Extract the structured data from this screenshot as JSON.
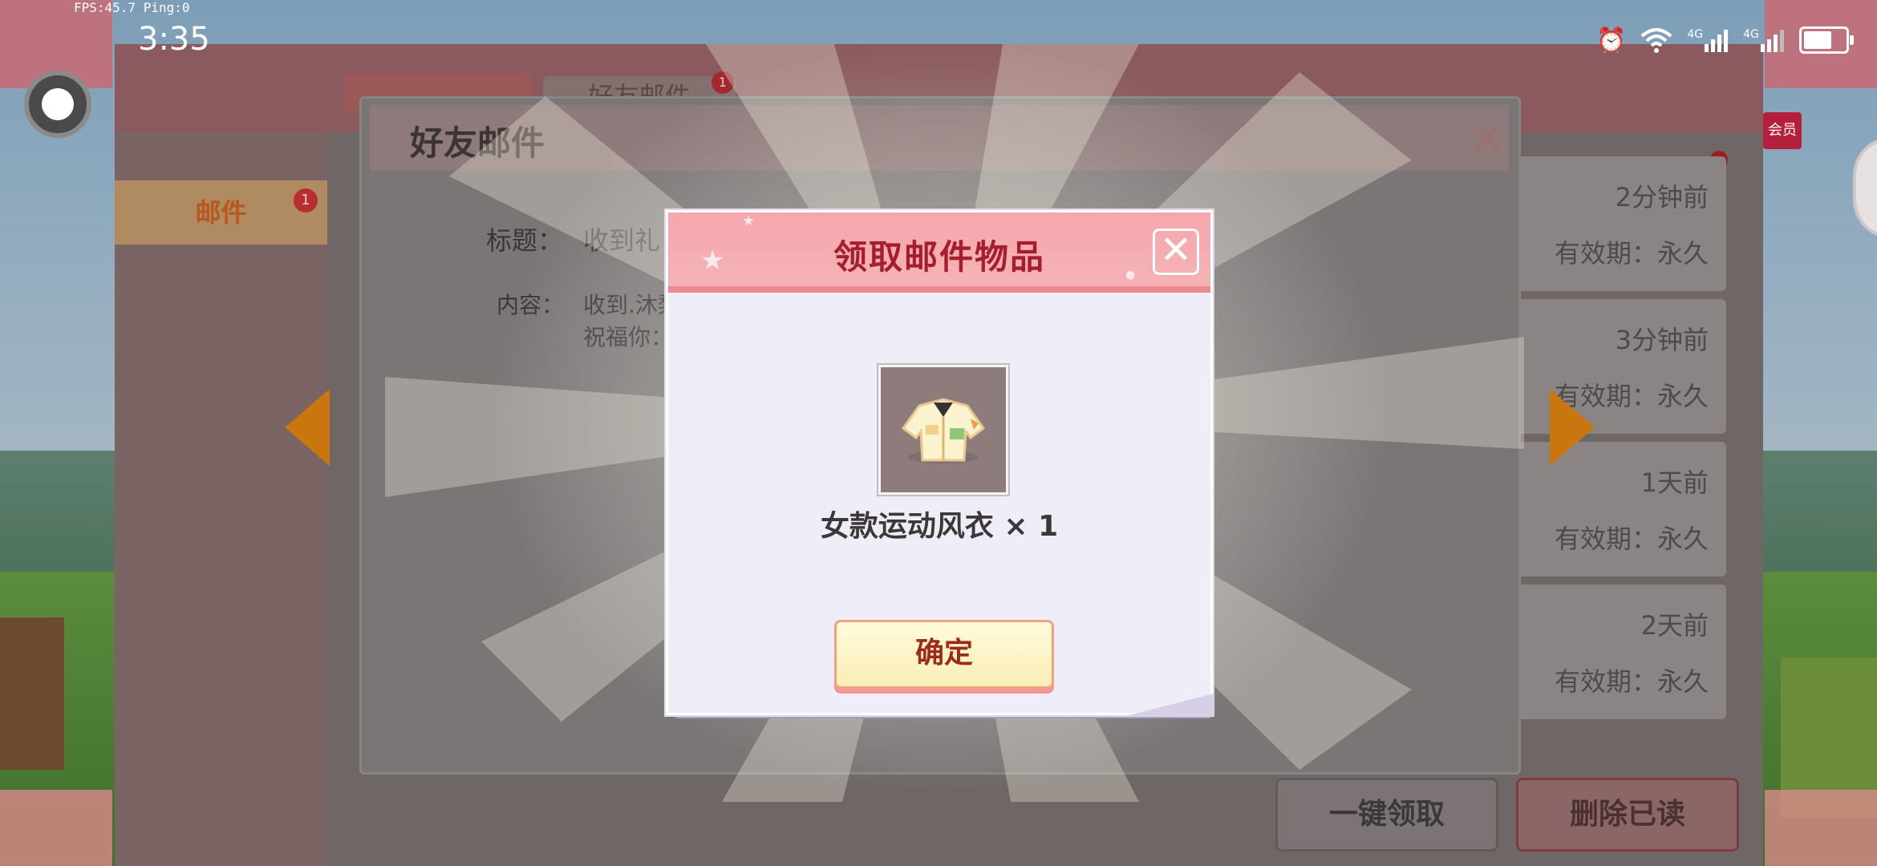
{
  "status_bar": {
    "fps_text": "FPS:45.7  Ping:0",
    "time": "3:35",
    "icons": [
      "alarm-icon",
      "wifi-icon",
      "signal-4g-icon",
      "signal-4g-icon",
      "battery-icon"
    ],
    "signal_label_1": "4G",
    "signal_label_2": "4G"
  },
  "mail_panel": {
    "sidebar_tabs": [
      {
        "label": "邮件",
        "badge": "1"
      },
      {
        "label": "",
        "badge": ""
      },
      {
        "label": "",
        "badge": ""
      }
    ],
    "top_tabs": [
      {
        "label": "",
        "badge": ""
      },
      {
        "label": "好友邮件",
        "badge": "1"
      }
    ],
    "mail_items": [
      {
        "time": "2分钟前",
        "expiry": "有效期：永久"
      },
      {
        "time": "3分钟前",
        "expiry": "有效期：永久"
      },
      {
        "time": "1天前",
        "expiry": "有效期：永久"
      },
      {
        "time": "2天前",
        "expiry": "有效期：永久"
      }
    ],
    "claim_all_label": "一键领取",
    "delete_read_label": "删除已读",
    "vip_badge": "会员"
  },
  "friend_mail_dialog": {
    "title": "好友邮件",
    "subject_label": "标题：",
    "subject_value": "收到礼",
    "content_label": "内容：",
    "content_line1": "收到.沐梨",
    "content_line2": "祝福你："
  },
  "claim_modal": {
    "title": "领取邮件物品",
    "item_name": "女款运动风衣 × 1",
    "item_icon": "jacket-icon",
    "confirm_label": "确定",
    "accent_color": "#a51e2d",
    "header_color": "#f6a7ad"
  }
}
